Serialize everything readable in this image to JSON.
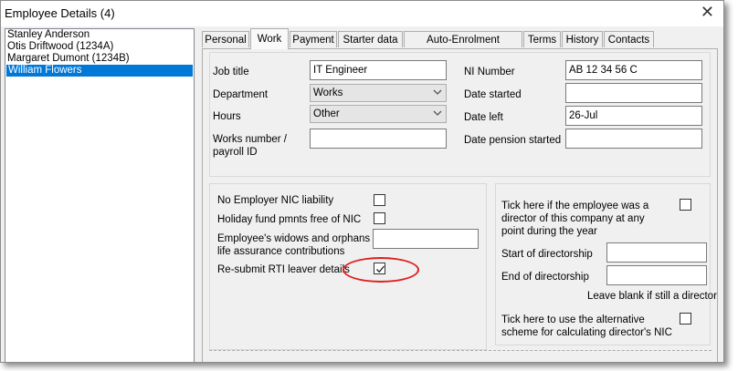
{
  "window": {
    "title": "Employee Details (4)",
    "close_symbol": "✕"
  },
  "employees": [
    {
      "name": "Stanley Anderson"
    },
    {
      "name": "Otis Driftwood (1234A)"
    },
    {
      "name": "Margaret Dumont (1234B)"
    },
    {
      "name": "William Flowers",
      "selected": true
    }
  ],
  "tabs": [
    "Personal",
    "Work",
    "Payment",
    "Starter data",
    "Auto-Enrolment pensions",
    "Terms",
    "History",
    "Contacts"
  ],
  "active_tab": "Work",
  "work": {
    "job_title": {
      "label": "Job title",
      "value": "IT Engineer"
    },
    "department": {
      "label": "Department",
      "value": "Works"
    },
    "hours": {
      "label": "Hours",
      "value": "Other"
    },
    "works_number": {
      "label_line1": "Works number /",
      "label_line2": "payroll ID",
      "value": ""
    },
    "ni_number": {
      "label": "NI Number",
      "value": "AB 12 34 56 C"
    },
    "date_started": {
      "label": "Date started",
      "value": ""
    },
    "date_left": {
      "label": "Date left",
      "value": "26-Jul"
    },
    "date_pension_started": {
      "label": "Date pension started",
      "value": ""
    }
  },
  "nic": {
    "no_employer_nic": {
      "label": "No Employer NIC liability",
      "checked": false
    },
    "holiday_fund": {
      "label": "Holiday fund pmnts free of NIC",
      "checked": false
    },
    "widows_orphans": {
      "label_line1": "Employee's widows and orphans /",
      "label_line2": "life assurance contributions",
      "value": ""
    },
    "resubmit_rti": {
      "label": "Re-submit RTI leaver details",
      "checked": true
    }
  },
  "director": {
    "was_director": {
      "label_line1": "Tick here if the employee was a",
      "label_line2": "director of this company at any",
      "label_line3": "point during the year",
      "checked": false
    },
    "start": {
      "label": "Start of directorship",
      "value": ""
    },
    "end": {
      "label": "End of directorship",
      "value": ""
    },
    "hint": "Leave blank if still a director",
    "alt_scheme": {
      "label_line1": "Tick here to use the alternative",
      "label_line2": "scheme for calculating director's NIC",
      "checked": false
    }
  },
  "colors": {
    "selection": "#0078d7",
    "highlight_ring": "#e02020"
  },
  "icons": {
    "close": "close-icon",
    "dropdown": "chevron-down-icon",
    "check": "checkmark-icon"
  }
}
